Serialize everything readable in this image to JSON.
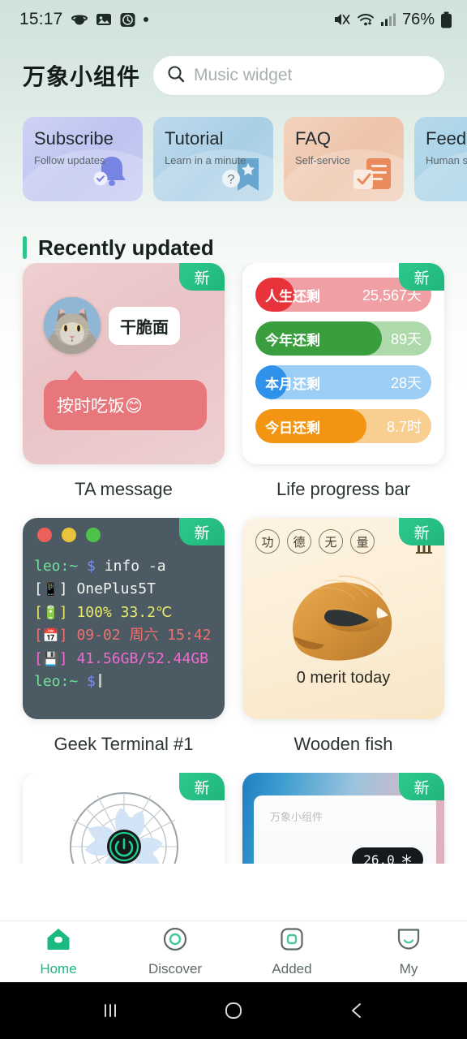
{
  "status_bar": {
    "time": "15:17",
    "battery_percent": "76%",
    "left_icons": [
      "saturn-icon",
      "image-icon",
      "alarm-icon",
      "dot-indicator-icon"
    ],
    "right_icons": [
      "mute-icon",
      "wifi-icon",
      "signal-icon",
      "battery-icon"
    ]
  },
  "header": {
    "brand": "万象小组件",
    "search_placeholder": "Music widget",
    "search_value": ""
  },
  "categories": [
    {
      "title": "Subscribe",
      "subtitle": "Follow updates",
      "icon": "bell-icon",
      "color": "#c3c9f2"
    },
    {
      "title": "Tutorial",
      "subtitle": "Learn in a minute",
      "icon": "question-bookmark-icon",
      "color": "#aed0e6"
    },
    {
      "title": "FAQ",
      "subtitle": "Self-service",
      "icon": "checklist-icon",
      "color": "#f0c6ad"
    },
    {
      "title": "Feedback",
      "subtitle": "Human service",
      "icon": "headset-icon",
      "color": "#abd4e8"
    }
  ],
  "section": {
    "title": "Recently updated",
    "accent_color": "#2fc48a"
  },
  "badges": {
    "new": "新"
  },
  "widgets": [
    {
      "caption": "TA message",
      "badge": "新",
      "name": "干脆面",
      "message": "按时吃饭😊",
      "avatar": "cat-avatar"
    },
    {
      "caption": "Life progress bar",
      "badge": "新",
      "bars": [
        {
          "label": "人生还剩",
          "value": "25,567天",
          "fill_percent": 22,
          "fill_color": "#e8333a",
          "track_color": "#f0a0a4"
        },
        {
          "label": "今年还剩",
          "value": "89天",
          "fill_percent": 72,
          "fill_color": "#3a9e3f",
          "track_color": "#aed9ab"
        },
        {
          "label": "本月还剩",
          "value": "28天",
          "fill_percent": 18,
          "fill_color": "#2e92ea",
          "track_color": "#9bcdf5"
        },
        {
          "label": "今日还剩",
          "value": "8.7时",
          "fill_percent": 63,
          "fill_color": "#f39512",
          "track_color": "#f9ce91"
        }
      ]
    },
    {
      "caption": "Geek Terminal #1",
      "badge": "新",
      "lines": [
        {
          "user": "leo",
          "sep": ":~",
          "prompt": "$",
          "cmd": "info -a"
        },
        {
          "bracket_icon": "phone-emoji",
          "text": "OnePlus5T",
          "color": "white"
        },
        {
          "bracket_icon": "battery-emoji",
          "text": "100% 33.2℃",
          "color": "yellow"
        },
        {
          "bracket_icon": "calendar-emoji",
          "text": "09-02 周六 15:42",
          "color": "red"
        },
        {
          "bracket_icon": "floppy-emoji",
          "text": "41.56GB/52.44GB",
          "color": "pink"
        },
        {
          "user": "leo",
          "sep": ":~",
          "prompt": "$",
          "cmd": ""
        }
      ]
    },
    {
      "caption": "Wooden fish",
      "badge": "新",
      "tags": [
        "功",
        "德",
        "无",
        "量"
      ],
      "merit_text": "0 merit today",
      "corner_icon": "temple-icon"
    },
    {
      "caption": "",
      "badge": "新",
      "type": "fan-widget"
    },
    {
      "caption": "",
      "badge": "新",
      "type": "air-conditioner-widget",
      "brand_watermark": "万象小组件",
      "temperature": "26.0",
      "mode_icon": "snowflake-icon"
    }
  ],
  "bottom_nav": {
    "items": [
      {
        "label": "Home",
        "icon": "home-icon",
        "active": true
      },
      {
        "label": "Discover",
        "icon": "compass-icon",
        "active": false
      },
      {
        "label": "Added",
        "icon": "square-icon",
        "active": false
      },
      {
        "label": "My",
        "icon": "profile-icon",
        "active": false
      }
    ],
    "active_color": "#19b97f",
    "inactive_color": "#5d6a66"
  },
  "system_nav": {
    "buttons": [
      {
        "icon": "recents-icon",
        "label": "|||"
      },
      {
        "icon": "home-circle-icon",
        "label": "O"
      },
      {
        "icon": "back-icon",
        "label": "<"
      }
    ]
  }
}
